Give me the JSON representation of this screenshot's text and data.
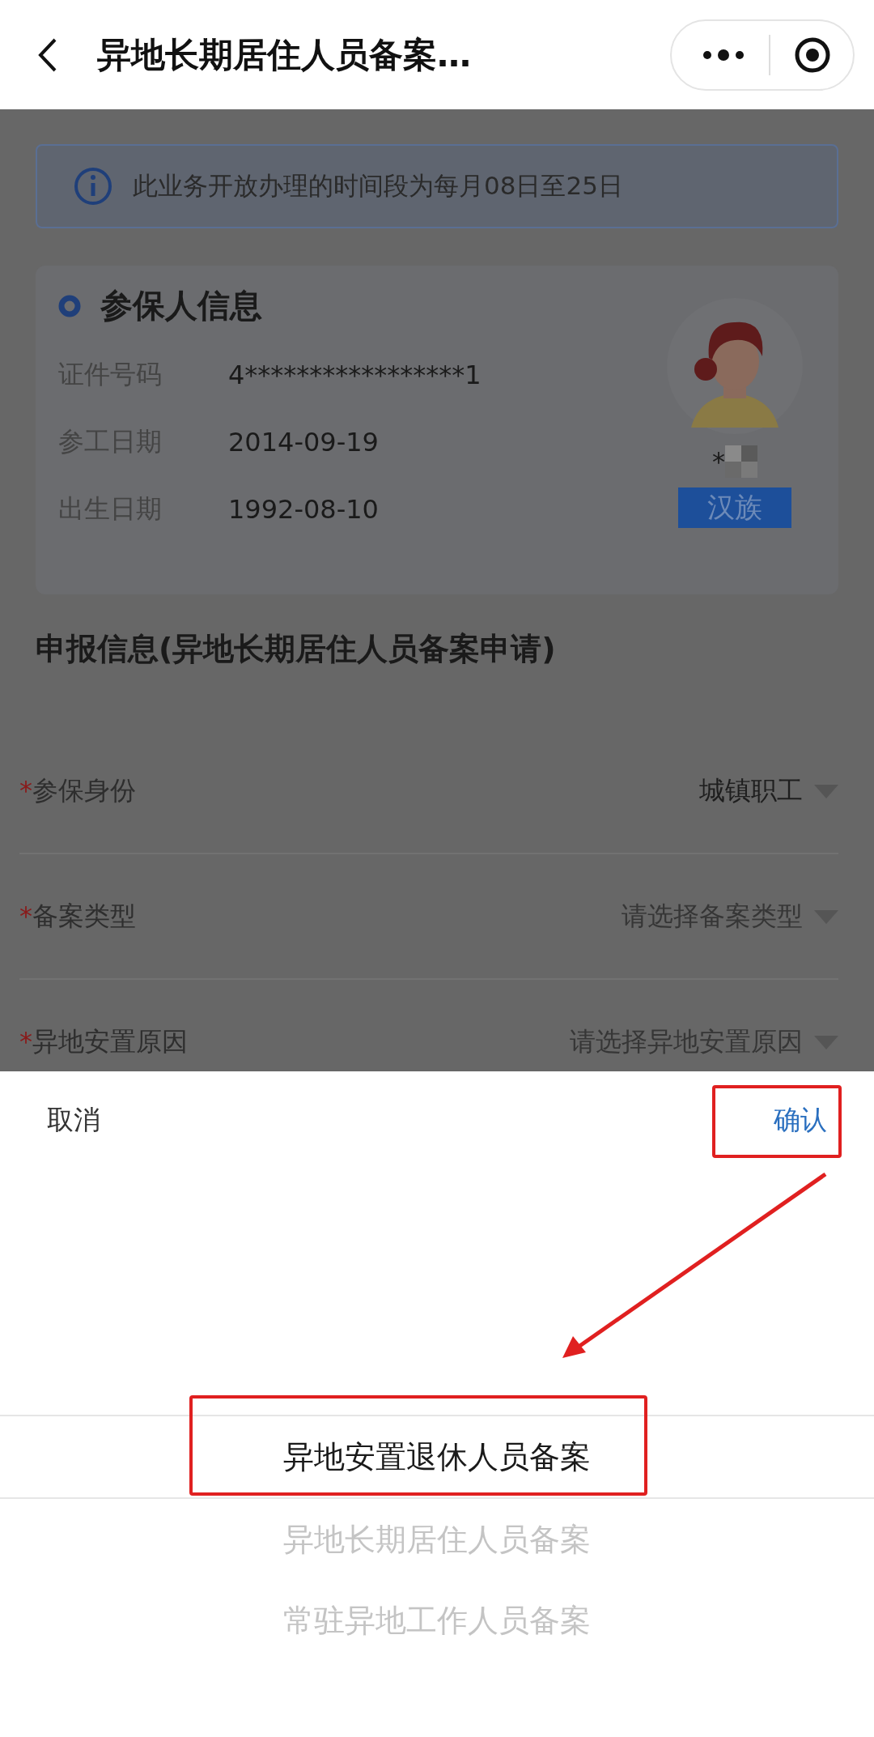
{
  "nav": {
    "title": "异地长期居住人员备案…"
  },
  "notice": {
    "text": "此业务开放办理的时间段为每月08日至25日"
  },
  "insured": {
    "title": "参保人信息",
    "fields": [
      {
        "label": "证件号码",
        "value": "4*****************1"
      },
      {
        "label": "参工日期",
        "value": "2014-09-19"
      },
      {
        "label": "出生日期",
        "value": "1992-08-10"
      }
    ],
    "name": "*",
    "ethnicity": "汉族"
  },
  "declaration": {
    "title": "申报信息(异地长期居住人员备案申请)",
    "fields": [
      {
        "label": "参保身份",
        "required": true,
        "value": "城镇职工"
      },
      {
        "label": "备案类型",
        "required": true,
        "placeholder": "请选择备案类型"
      },
      {
        "label": "异地安置原因",
        "required": true,
        "placeholder": "请选择异地安置原因"
      }
    ]
  },
  "picker": {
    "cancel": "取消",
    "confirm": "确认",
    "options": [
      {
        "label": "异地安置退休人员备案",
        "selected": true
      },
      {
        "label": "异地长期居住人员备案",
        "selected": false
      },
      {
        "label": "常驻异地工作人员备案",
        "selected": false
      }
    ]
  }
}
